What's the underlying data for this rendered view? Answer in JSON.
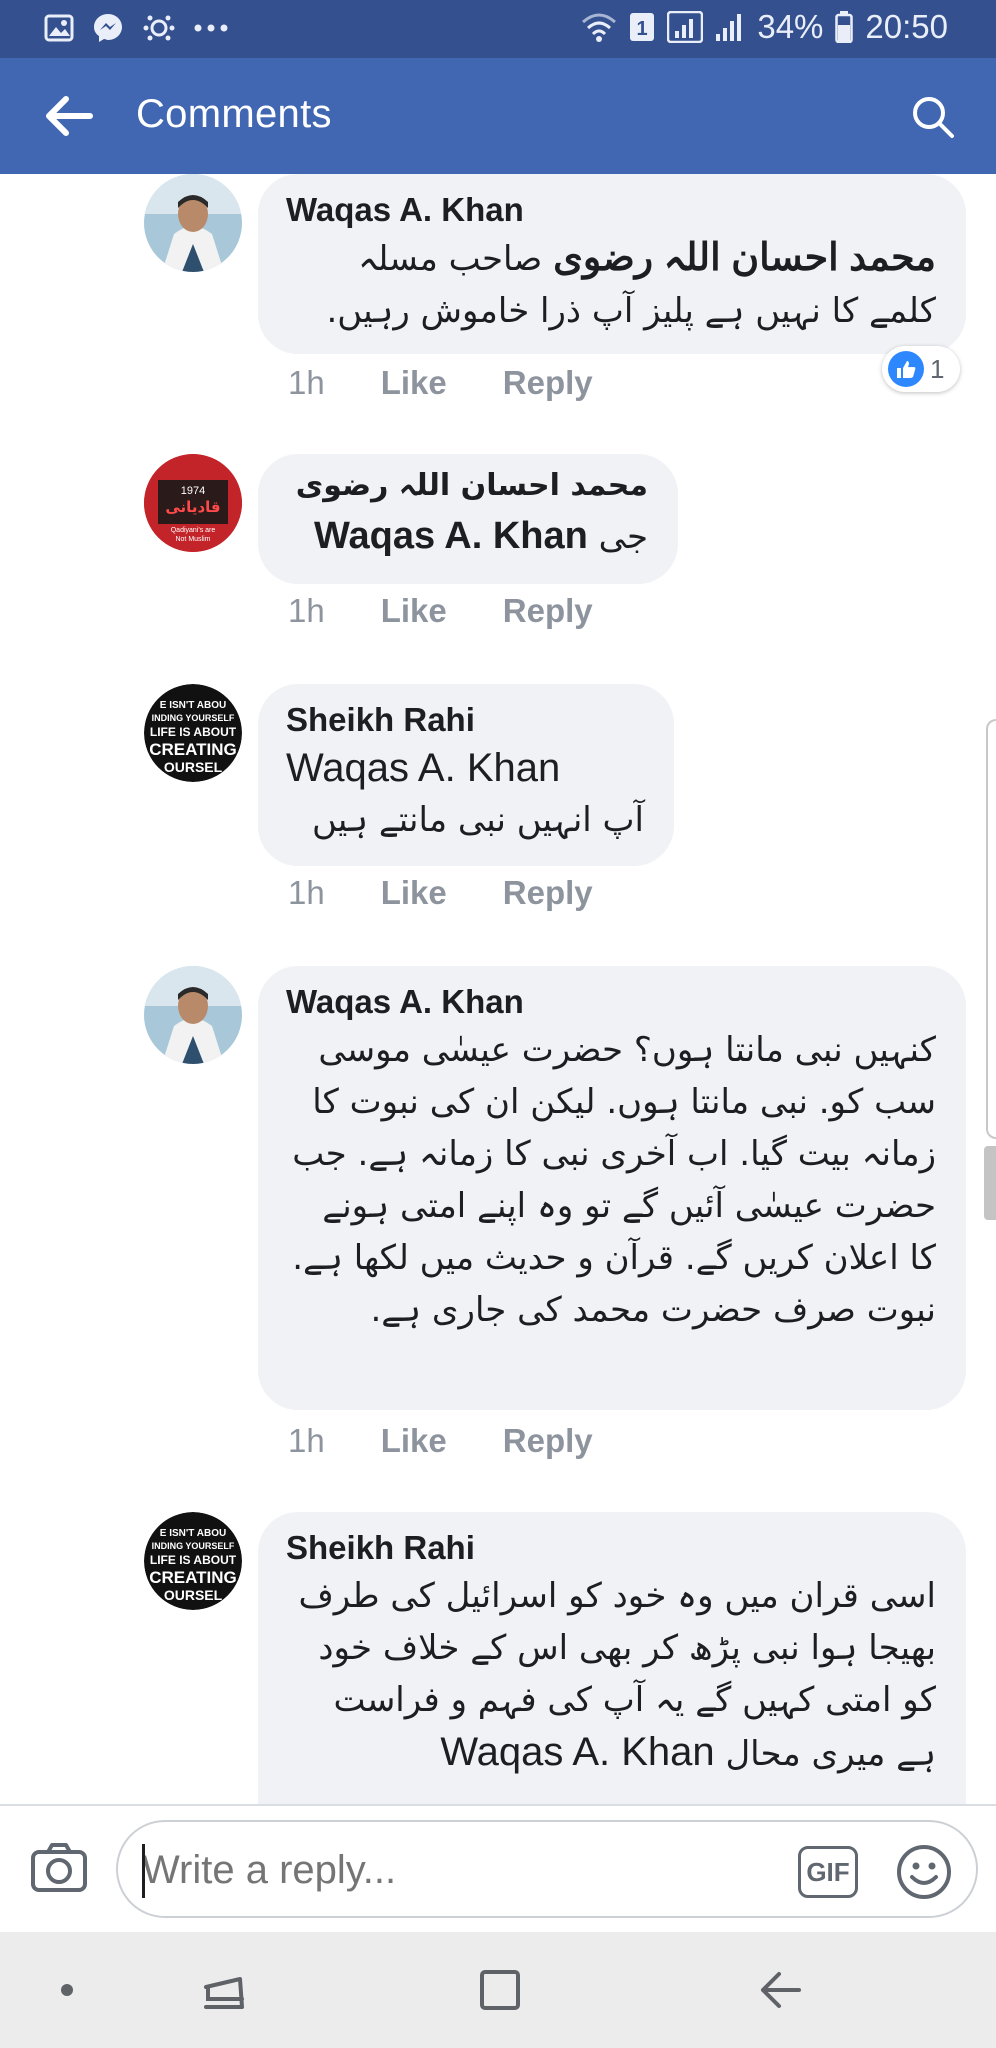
{
  "status_bar": {
    "left_icons": [
      "gallery-icon",
      "messenger-icon",
      "dots-burst-icon",
      "more-dots-icon"
    ],
    "sim_badge": "1",
    "battery_percent": "34%",
    "time": "20:50"
  },
  "header": {
    "title": "Comments",
    "back_icon": "arrow-left-icon",
    "search_icon": "search-icon"
  },
  "comments": [
    {
      "author": "Waqas A. Khan",
      "mention": "محمد احسان اللہ رضوی",
      "text": "صاحب مسلہ کلمے کا نہیں ہے پلیز آپ ذرا خاموش رہیں.",
      "time": "1h",
      "like_label": "Like",
      "reply_label": "Reply",
      "reaction_count": "1"
    },
    {
      "author": "محمد احسان اللہ رضوی",
      "mention": "Waqas A. Khan",
      "text": "جی",
      "time": "1h",
      "like_label": "Like",
      "reply_label": "Reply",
      "avatar_text": "1974 قادیانی Qadiyani's are Not Muslim"
    },
    {
      "author": "Sheikh Rahi",
      "mention": "Waqas A. Khan",
      "text": "آپ انہیں نبی مانتے ہیں",
      "time": "1h",
      "like_label": "Like",
      "reply_label": "Reply",
      "avatar_text": "LIFE ISN'T ABOUT FINDING YOURSELF LIFE IS ABOUT CREATING YOURSELF"
    },
    {
      "author": "Waqas A. Khan",
      "text": "کنہیں نبی مانتا ہوں؟ حضرت عیسٰی موسی سب کو. نبی مانتا ہوں. لیکن ان کی نبوت کا زمانہ بیت گیا. اب آخری نبی کا زمانہ ہے. جب حضرت عیسٰی آئیں گے تو وہ اپنے امتی ہونے کا اعلان کریں گے. قرآن و حدیث میں لکھا ہے. نبوت صرف حضرت محمد کی جاری ہے.",
      "time": "1h",
      "like_label": "Like",
      "reply_label": "Reply"
    },
    {
      "author": "Sheikh Rahi",
      "mention": "Waqas A. Khan",
      "text": "اسی قران میں وہ خود کو اسرائیل کی طرف بھیجا ہوا نبی پڑھ کر بھی اس کے خلاف خود کو امتی کہیں گے یہ آپ کی فہم و فراست ہے میری محال",
      "avatar_text": "LIFE ISN'T ABOUT FINDING YOURSELF LIFE IS ABOUT CREATING YOURSELF"
    }
  ],
  "composer": {
    "placeholder": "Write a reply...",
    "gif_label": "GIF",
    "camera_icon": "camera-icon",
    "emoji_icon": "smiley-icon"
  },
  "nav_bar": {
    "icons": [
      "dot-icon",
      "recent-apps-icon",
      "home-square-icon",
      "back-arrow-icon"
    ]
  },
  "colors": {
    "brand_blue": "#4267b2",
    "status_blue": "#34508f",
    "bubble_gray": "#f0f2f5",
    "meta_gray": "#8d949e",
    "like_blue": "#2d88ff"
  }
}
